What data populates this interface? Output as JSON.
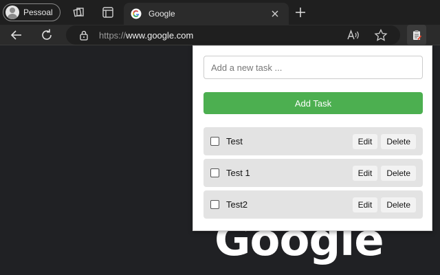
{
  "browser": {
    "profile": {
      "label": "Pessoal"
    },
    "tab": {
      "title": "Google"
    },
    "address_bar": {
      "scheme": "https://",
      "host": "www.google.com"
    }
  },
  "page": {
    "logo_text": "Google"
  },
  "popup": {
    "input": {
      "placeholder": "Add a new task ...",
      "value": ""
    },
    "add_button_label": "Add Task",
    "accent_color": "#4caf50",
    "tasks": [
      {
        "label": "Test",
        "checked": false,
        "edit_label": "Edit",
        "delete_label": "Delete"
      },
      {
        "label": "Test 1",
        "checked": false,
        "edit_label": "Edit",
        "delete_label": "Delete"
      },
      {
        "label": "Test2",
        "checked": false,
        "edit_label": "Edit",
        "delete_label": "Delete"
      }
    ]
  }
}
